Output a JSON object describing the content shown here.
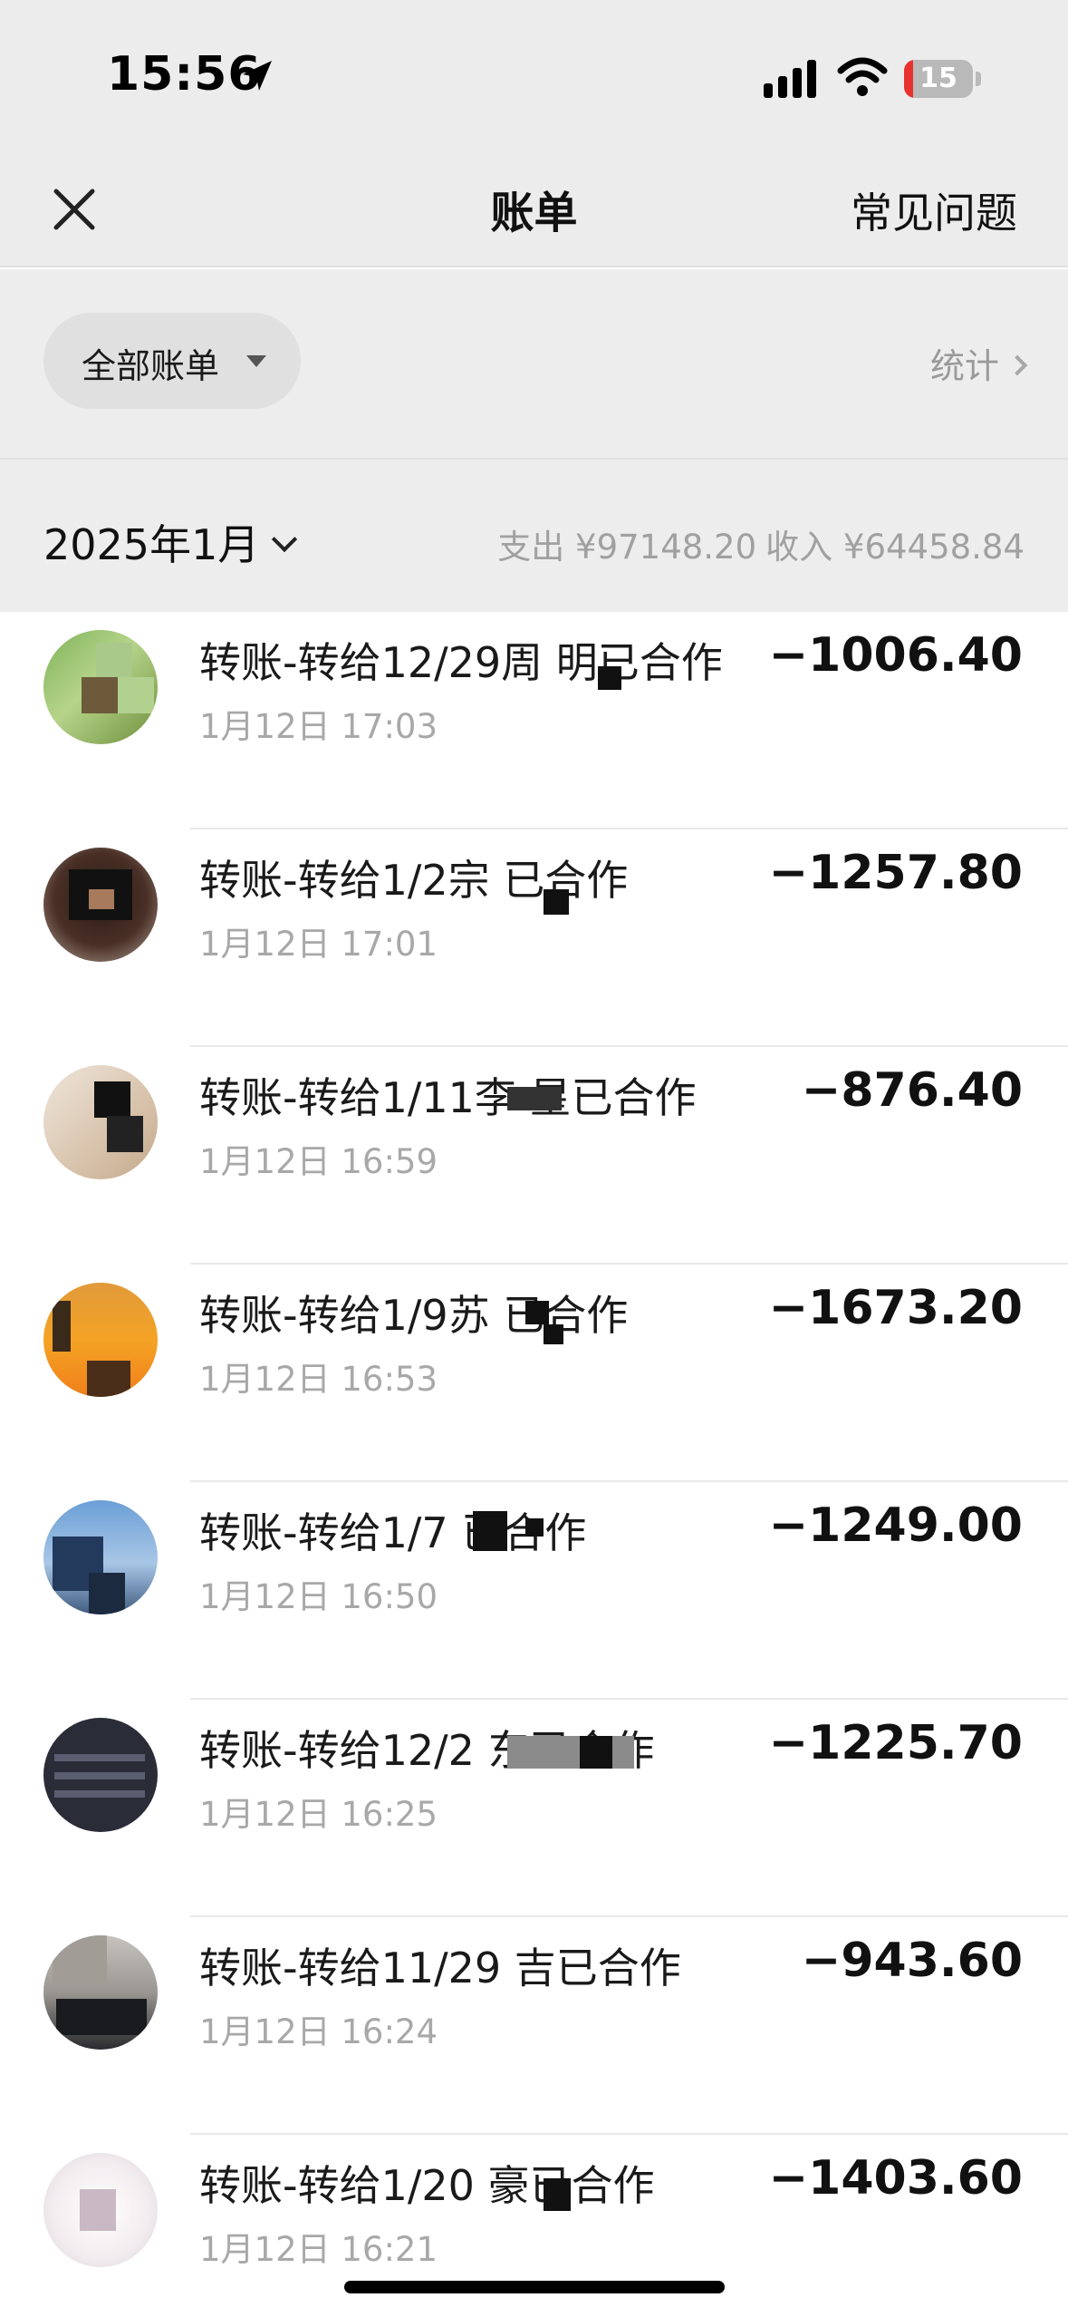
{
  "status_bar": {
    "time": "15:56",
    "battery_level": "15"
  },
  "nav": {
    "title": "账单",
    "faq": "常见问题"
  },
  "filter": {
    "label": "全部账单",
    "stats": "统计"
  },
  "month": {
    "label": "2025年1月",
    "expense": "支出 ¥97148.20",
    "income": "收入 ¥64458.84"
  },
  "transactions": [
    {
      "title": "转账-转给12/29周    明已合作",
      "time": "1月12日 17:03",
      "amount": "−1006.40"
    },
    {
      "title": "转账-转给1/2宗     已合作",
      "time": "1月12日 17:01",
      "amount": "−1257.80"
    },
    {
      "title": "转账-转给1/11李    星已合作",
      "time": "1月12日 16:59",
      "amount": "−876.40"
    },
    {
      "title": "转账-转给1/9苏     已合作",
      "time": "1月12日 16:53",
      "amount": "−1673.20"
    },
    {
      "title": "转账-转给1/7       已合作",
      "time": "1月12日 16:50",
      "amount": "−1249.00"
    },
    {
      "title": "转账-转给12/2       东已合作",
      "time": "1月12日 16:25",
      "amount": "−1225.70"
    },
    {
      "title": "转账-转给11/29    吉已合作",
      "time": "1月12日 16:24",
      "amount": "−943.60"
    },
    {
      "title": "转账-转给1/20      豪已合作",
      "time": "1月12日 16:21",
      "amount": "−1403.60"
    }
  ]
}
